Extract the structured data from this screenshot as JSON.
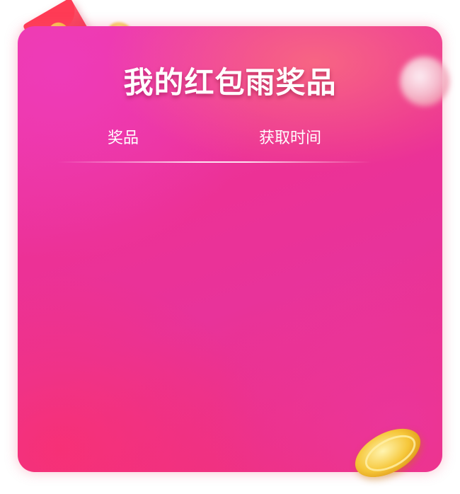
{
  "dialog": {
    "title": "我的红包雨奖品",
    "columns": {
      "prize": "奖品",
      "time": "获取时间"
    },
    "rows": []
  },
  "decor": {
    "envelope_symbol": "¥",
    "icons": [
      "red-envelope-icon",
      "gold-coin-icon",
      "blurred-ball-icon",
      "gold-coin-large-icon"
    ]
  },
  "colors": {
    "card_gradient_start": "#ee3aa6",
    "card_gradient_end": "#f1307a",
    "text": "#ffffff"
  }
}
